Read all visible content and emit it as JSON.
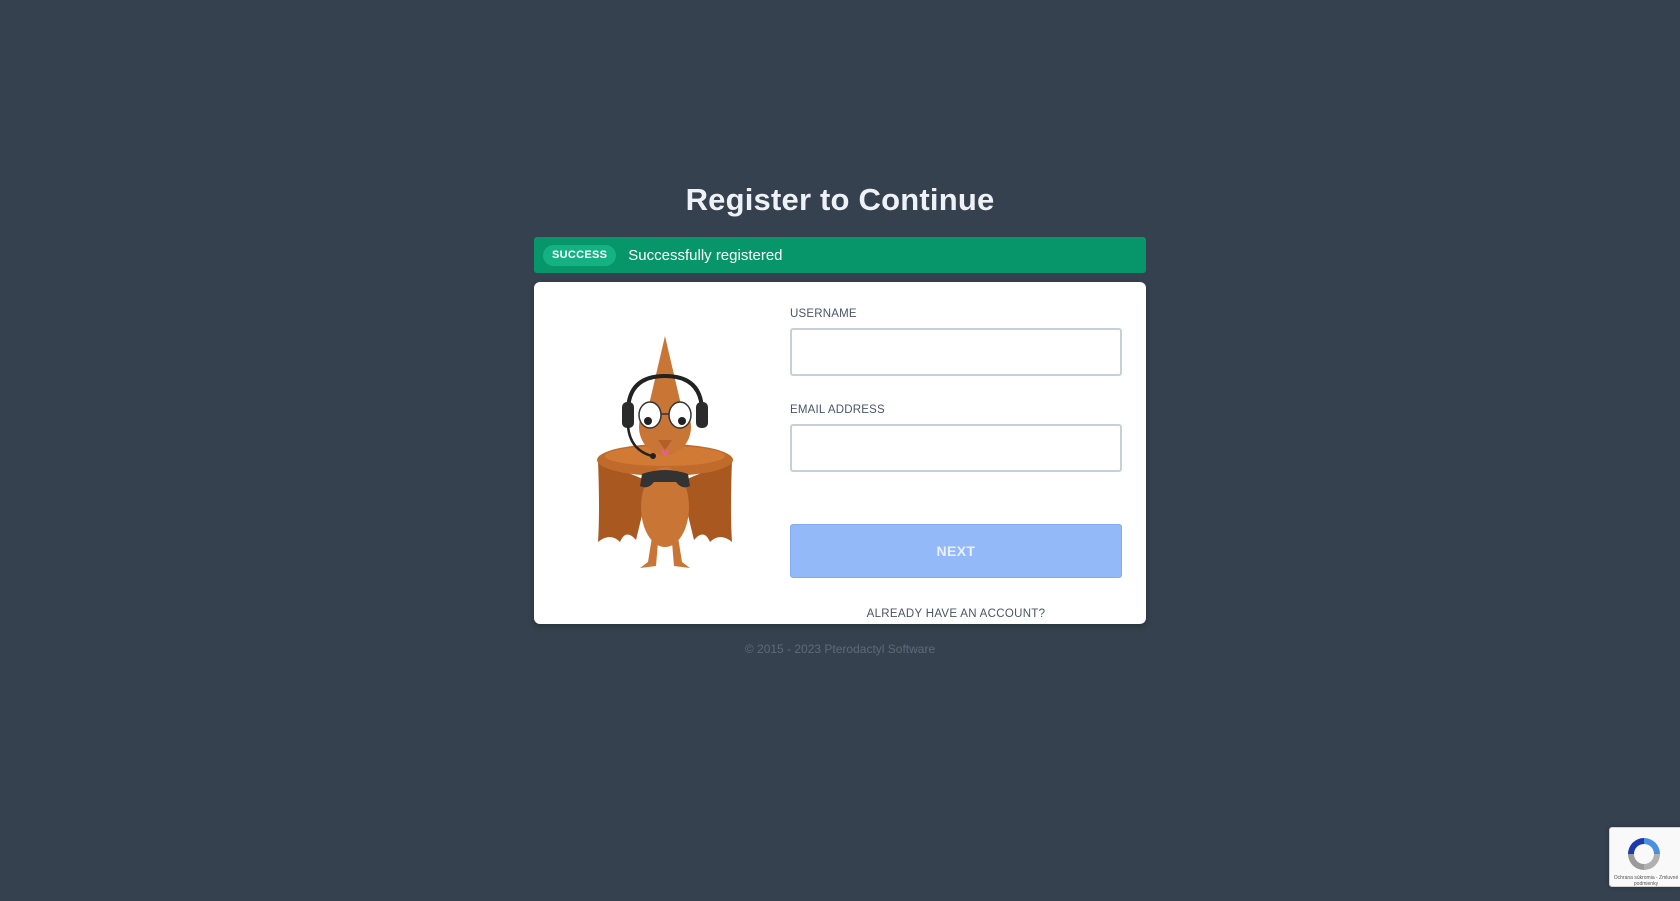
{
  "page": {
    "title": "Register to Continue"
  },
  "alert": {
    "badge": "SUCCESS",
    "message": "Successfully registered",
    "color": "#07956a"
  },
  "form": {
    "username_label": "USERNAME",
    "username_value": "",
    "email_label": "EMAIL ADDRESS",
    "email_value": "",
    "next_label": "NEXT",
    "login_link": "ALREADY HAVE AN ACCOUNT?"
  },
  "mascot": {
    "icon": "pterodactyl-mascot"
  },
  "footer": {
    "text": "© 2015 - 2023 Pterodactyl Software"
  },
  "recaptcha": {
    "icon": "recaptcha-icon",
    "text": "Ochrana súkromia - Zmluvné podmienky"
  },
  "colors": {
    "background": "#35414f",
    "button": "#93b9f8",
    "card": "#ffffff"
  }
}
